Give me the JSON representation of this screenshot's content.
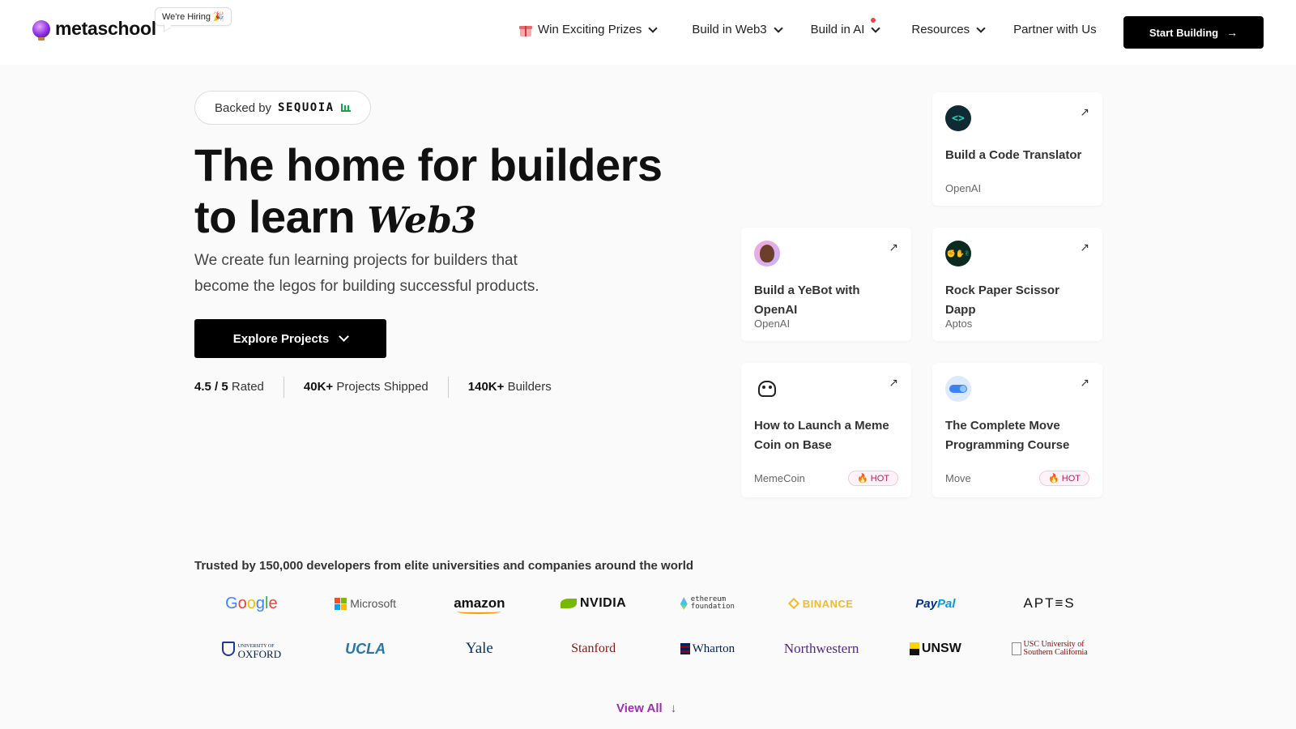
{
  "header": {
    "brand": "metaschool",
    "hiring_badge": "We're Hiring 🎉",
    "nav": [
      {
        "label": "Win Exciting Prizes",
        "icon": "gift-icon"
      },
      {
        "label": "Build in Web3"
      },
      {
        "label": "Build in AI",
        "dot_color": "#ef4444"
      },
      {
        "label": "Resources"
      },
      {
        "label": "Partner with Us"
      }
    ],
    "cta": "Start Building"
  },
  "hero": {
    "backed_by": "Backed by",
    "backer": "SEQUOIA",
    "headline_line1": "The home for builders",
    "headline_line2_prefix": "to learn",
    "headline_word": "Web3",
    "subtext": "We create fun learning projects for builders that become the legos for building successful products.",
    "explore_button": "Explore Projects",
    "stats": [
      {
        "value": "4.5 / 5",
        "label": "Rated"
      },
      {
        "value": "40K+",
        "label": "Projects Shipped"
      },
      {
        "value": "140K+",
        "label": "Builders"
      }
    ]
  },
  "cards": [
    {
      "title": "Build a Code Translator",
      "tag": "OpenAI",
      "icon": "code-brackets-icon"
    },
    {
      "title": "Build a YeBot with OpenAI",
      "tag": "OpenAI",
      "icon": "avatar-face-icon"
    },
    {
      "title": "Rock Paper Scissor Dapp",
      "tag": "Aptos",
      "icon": "rock-paper-scissor-icon"
    },
    {
      "title": "How to Launch a Meme Coin on Base",
      "tag": "MemeCoin",
      "badge": "🔥 HOT",
      "icon": "meme-frog-icon"
    },
    {
      "title": "The Complete Move Programming Course",
      "tag": "Move",
      "badge": "🔥 HOT",
      "icon": "move-toggle-icon"
    }
  ],
  "trusted": {
    "heading": "Trusted by 150,000 developers from elite universities and companies around the world",
    "logos": {
      "google": "Google",
      "microsoft": "Microsoft",
      "amazon": "amazon",
      "nvidia": "NVIDIA",
      "ethereum_1": "ethereum",
      "ethereum_2": "foundation",
      "binance": "BINANCE",
      "paypal_1": "Pay",
      "paypal_2": "Pal",
      "aptos": "APT≡S",
      "oxford_1": "UNIVERSITY OF",
      "oxford_2": "OXFORD",
      "ucla": "UCLA",
      "yale": "Yale",
      "stanford": "Stanford",
      "wharton": "Wharton",
      "northwestern": "Northwestern",
      "unsw": "UNSW",
      "usc_1": "USC University of",
      "usc_2": "Southern California"
    },
    "view_all": "View All"
  },
  "colors": {
    "accent_purple": "#9b2fae",
    "hot_pink": "#be185d",
    "cta_black": "#000000"
  }
}
